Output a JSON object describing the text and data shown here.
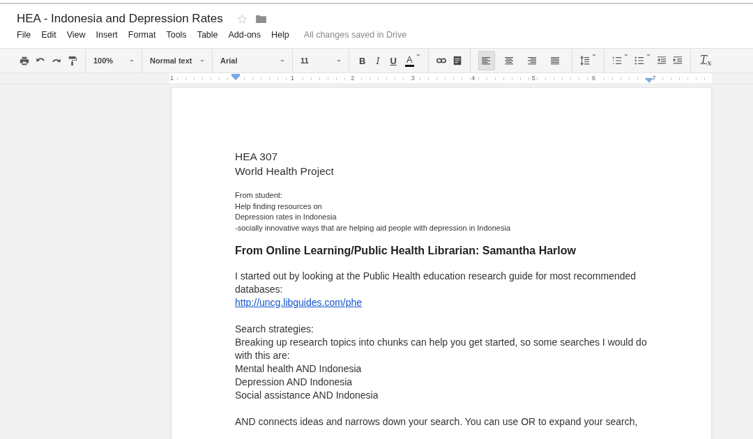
{
  "document_title": "HEA - Indonesia and Depression Rates",
  "starred": false,
  "menu": [
    "File",
    "Edit",
    "View",
    "Insert",
    "Format",
    "Tools",
    "Table",
    "Add-ons",
    "Help"
  ],
  "save_status": "All changes saved in Drive",
  "toolbar": {
    "zoom": "100%",
    "style": "Normal text",
    "font": "Arial",
    "size": "11",
    "bold": "B",
    "italic": "I",
    "underline": "U",
    "text_color": "A",
    "clear_formatting": "T$_{x}$",
    "alignments": [
      {
        "kind": "left",
        "selected": true
      },
      {
        "kind": "center",
        "selected": false
      },
      {
        "kind": "right",
        "selected": false
      },
      {
        "kind": "justify",
        "selected": false
      }
    ]
  },
  "ruler": {
    "labels": [
      "1",
      "1",
      "2",
      "3",
      "4",
      "5",
      "6",
      "7"
    ]
  },
  "paragraphs": [
    {
      "kind": "title",
      "lines": [
        "HEA 307",
        "World Health Project"
      ]
    },
    {
      "kind": "small",
      "lines": [
        "From student:",
        "Help finding resources on",
        "Depression rates in Indonesia",
        "-socially innovative ways that are helping aid people with depression in Indonesia"
      ]
    },
    {
      "kind": "heading",
      "lines": [
        "From Online Learning/Public Health Librarian: Samantha Harlow"
      ]
    },
    {
      "kind": "body",
      "lines": [
        "I started out by looking at the Public Health education research guide for most recommended",
        "databases:"
      ]
    },
    {
      "kind": "link",
      "lines": [
        "http://uncg.libguides.com/phe"
      ]
    },
    {
      "kind": "body",
      "lines": [
        "Search strategies:",
        "Breaking up research topics into chunks can help you get started, so some searches I would do",
        "with this are:",
        "Mental health AND Indonesia",
        "Depression AND Indonesia",
        "Social assistance AND Indonesia"
      ]
    },
    {
      "kind": "body",
      "lines": [
        "AND connects ideas and narrows down your search.  You can use OR to expand your search,"
      ]
    }
  ]
}
